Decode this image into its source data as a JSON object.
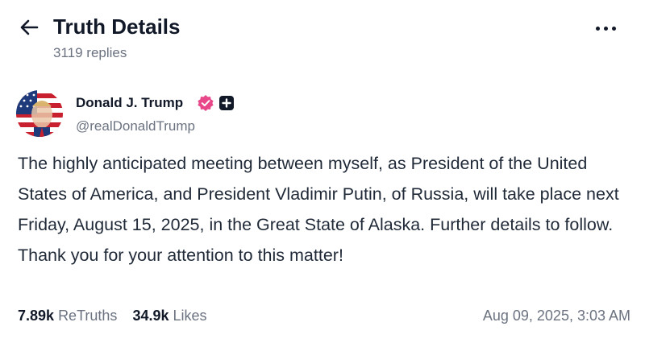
{
  "header": {
    "title": "Truth Details",
    "replies": "3119 replies",
    "back_icon": "arrow-left-icon",
    "more_icon": "ellipsis-icon"
  },
  "post": {
    "author_name": "Donald J. Trump",
    "handle": "@realDonaldTrump",
    "verified_color": "#e8488a",
    "text": "The highly anticipated meeting between myself, as President of the United States of America, and President Vladimir Putin, of Russia, will take place next Friday, August 15, 2025, in the Great State of Alaska. Further details to follow. Thank you for your attention to this matter!",
    "retruths_count": "7.89k",
    "retruths_label": "ReTruths",
    "likes_count": "34.9k",
    "likes_label": "Likes",
    "timestamp": "Aug 09, 2025, 3:03 AM"
  }
}
